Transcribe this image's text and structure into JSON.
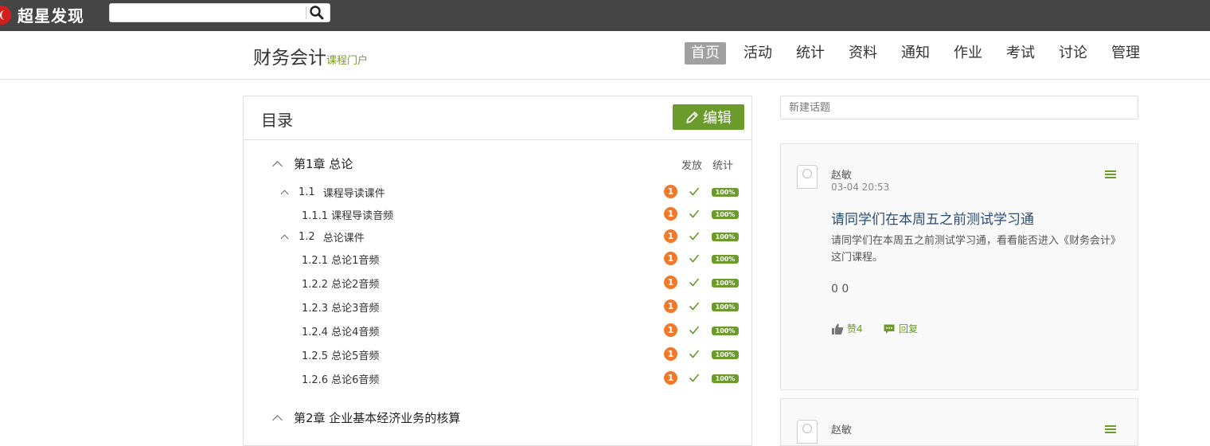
{
  "topbar": {
    "logo_text": "超星发现",
    "search_value": "",
    "search_icon": "search-icon"
  },
  "header": {
    "course_title": "财务会计",
    "course_sub": "课程门户",
    "nav": [
      {
        "label": "首页",
        "active": true
      },
      {
        "label": "活动"
      },
      {
        "label": "统计"
      },
      {
        "label": "资料"
      },
      {
        "label": "通知"
      },
      {
        "label": "作业"
      },
      {
        "label": "考试"
      },
      {
        "label": "讨论"
      },
      {
        "label": "管理"
      }
    ]
  },
  "toc": {
    "title": "目录",
    "edit_label": "编辑",
    "col_publish": "发放",
    "col_stats": "统计",
    "chapter1": "第1章 总论",
    "chapter2": "第2章 企业基本经济业务的核算",
    "rows": [
      {
        "kind": "sec",
        "num": "1.1",
        "label": "课程导读课件",
        "badge": "1",
        "pct": "100%"
      },
      {
        "kind": "sub",
        "num": "1.1.1",
        "label": "课程导读音频",
        "badge": "1",
        "pct": "100%"
      },
      {
        "kind": "sec",
        "num": "1.2",
        "label": "总论课件",
        "badge": "1",
        "pct": "100%"
      },
      {
        "kind": "sub",
        "num": "1.2.1",
        "label": "总论1音频",
        "badge": "1",
        "pct": "100%"
      },
      {
        "kind": "sub",
        "num": "1.2.2",
        "label": "总论2音频",
        "badge": "1",
        "pct": "100%"
      },
      {
        "kind": "sub",
        "num": "1.2.3",
        "label": "总论3音频",
        "badge": "1",
        "pct": "100%"
      },
      {
        "kind": "sub",
        "num": "1.2.4",
        "label": "总论4音频",
        "badge": "1",
        "pct": "100%"
      },
      {
        "kind": "sub",
        "num": "1.2.5",
        "label": "总论5音频",
        "badge": "1",
        "pct": "100%"
      },
      {
        "kind": "sub",
        "num": "1.2.6",
        "label": "总论6音频",
        "badge": "1",
        "pct": "100%"
      }
    ]
  },
  "sidebar": {
    "new_topic_placeholder": "新建话题",
    "post1": {
      "author": "赵敏",
      "time": "03-04 20:53",
      "title": "请同学们在本周五之前测试学习通",
      "body": "请同学们在本周五之前测试学习通，看看能否进入《财务会计》这门课程。",
      "stats": "0 0",
      "like_label": "赞4",
      "reply_label": "回复"
    },
    "post2": {
      "author": "赵敏"
    }
  },
  "colors": {
    "accent_green": "#6b9b2a",
    "badge_orange": "#f07a2a",
    "topbar": "#454545"
  }
}
